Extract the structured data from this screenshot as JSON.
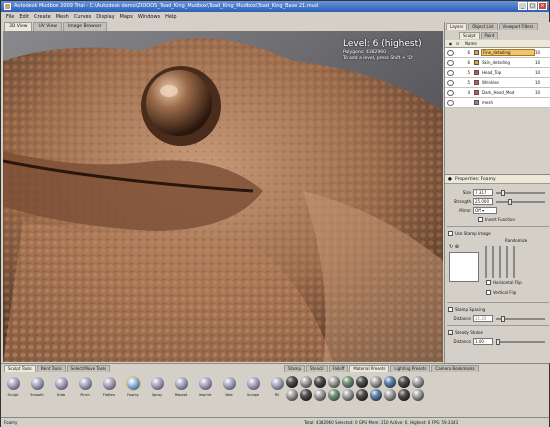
{
  "app": {
    "title": "Autodesk Mudbox 2009 Trial - C:\\Autodesk demo\\ZIOOOS_Toad_King_Mudbox\\Toad_King_Mudbox\\Toad_King_Base 21.mud"
  },
  "menu": [
    "File",
    "Edit",
    "Create",
    "Mesh",
    "Curves",
    "Display",
    "Maps",
    "Windows",
    "Help"
  ],
  "view_tabs": [
    "3D View",
    "UV View",
    "Image Browser"
  ],
  "hud": {
    "level": "Level: 6 (highest)",
    "polygons": "Polygons: 4382960",
    "hint": "To add a level, press Shift + 'D'"
  },
  "right_panel": {
    "tabs": [
      "Layers",
      "Object List",
      "Viewport Filters"
    ],
    "subtabs": [
      "Sculpt",
      "Paint"
    ],
    "header_name": "Name",
    "layers": [
      {
        "num": "6",
        "name": "Fine_detailing",
        "pct": "10",
        "color": "#e8a040",
        "selected": true
      },
      {
        "num": "6",
        "name": "Skin_detailing",
        "pct": "10",
        "color": "#e8a040",
        "selected": false
      },
      {
        "num": "5",
        "name": "Head_Top",
        "pct": "10",
        "color": "#d05050",
        "selected": false
      },
      {
        "num": "5",
        "name": "Wrinkles",
        "pct": "10",
        "color": "#d05050",
        "selected": false
      },
      {
        "num": "4",
        "name": "Dark_Head_Mod",
        "pct": "10",
        "color": "#d05050",
        "selected": false
      },
      {
        "num": "",
        "name": "mesh",
        "pct": "",
        "color": "#888888",
        "selected": false
      }
    ]
  },
  "properties": {
    "title": "Properties: Foamy",
    "size_label": "Size",
    "size_value": "7.317",
    "strength_label": "Strength",
    "strength_value": "25.000",
    "mirror_label": "Mirror",
    "mirror_value": "Off",
    "invert_label": "Invert Function",
    "use_stamp_label": "Use Stamp Image",
    "randomize_label": "Randomize",
    "horizontal_flip_label": "Horizontal Flip",
    "vertical_flip_label": "Vertical Flip",
    "stamp_spacing_label": "Stamp Spacing",
    "distance_label": "Distance",
    "distance_value": "11.25",
    "steady_stroke_label": "Steady Stroke",
    "steady_distance_label": "Distance",
    "steady_distance_value": "1.00"
  },
  "bottom": {
    "left_tabs": [
      "Sculpt Tools",
      "Paint Tools",
      "Select/Move Tools"
    ],
    "right_tabs": [
      "Stamp",
      "Stencil",
      "Falloff",
      "Material Presets",
      "Lighting Presets",
      "Camera Bookmarks"
    ],
    "tools": [
      "Sculpt",
      "Smooth",
      "Grab",
      "Pinch",
      "Flatten",
      "Foamy",
      "Spray",
      "Repeat",
      "Imprint",
      "Wax",
      "Scrape",
      "Fill"
    ]
  },
  "status": {
    "left": "Foamy",
    "right": "Total: 4382960  Selected: 0  GPU Mem: 210  Active: 6, Highest: 6  FPS: 59.3343"
  },
  "colors": {
    "accent": "#2a5fb8",
    "skin": "#9a6a4a",
    "panel": "#d4d0c8"
  }
}
